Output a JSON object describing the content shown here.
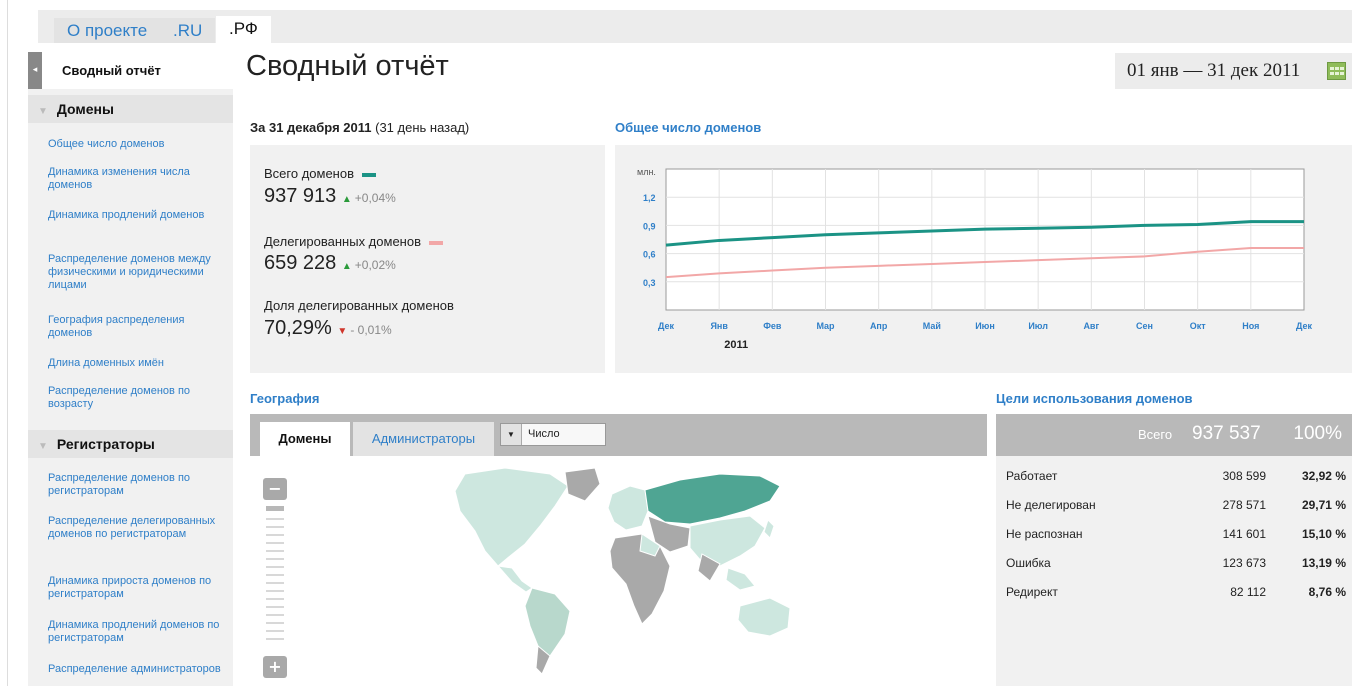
{
  "top_tabs": [
    {
      "label": "О проекте"
    },
    {
      "label": ".RU"
    },
    {
      "label": ".РФ"
    }
  ],
  "sidebar": {
    "active_item": "Сводный отчёт",
    "groups": [
      {
        "title": "Домены",
        "items": [
          "Общее число доменов",
          "Динамика изменения числа доменов",
          "Динамика продлений доменов",
          "Распределение доменов между физическими и юридическими лицами",
          "География распределения доменов",
          "Длина доменных имён",
          "Распределение доменов по возрасту"
        ]
      },
      {
        "title": "Регистраторы",
        "items": [
          "Распределение доменов по регистраторам",
          "Распределение делегированных доменов по регистраторам",
          "Динамика прироста доменов по регистраторам",
          "Динамика продлений доменов по регистраторам",
          "Распределение администраторов"
        ]
      }
    ]
  },
  "header": {
    "title": "Сводный отчёт",
    "date_range": "01 янв — 31 дек 2011"
  },
  "stats": {
    "heading_bold": "За 31 декабря 2011",
    "heading_rest": "(31 день назад)",
    "items": [
      {
        "label": "Всего доменов",
        "value": "937 913",
        "change": "+0,04%",
        "direction": "up",
        "color": "#1b9385"
      },
      {
        "label": "Делегированных доменов",
        "value": "659 228",
        "change": "+0,02%",
        "direction": "up",
        "color": "#f2a7a7"
      },
      {
        "label": "Доля делегированных доменов",
        "value": "70,29%",
        "change": "- 0,01%",
        "direction": "down"
      }
    ]
  },
  "chart_title": "Общее число доменов",
  "chart_data": {
    "type": "line",
    "unit_label": "млн.",
    "x": [
      "Дек",
      "Янв",
      "Фев",
      "Мар",
      "Апр",
      "Май",
      "Июн",
      "Июл",
      "Авг",
      "Сен",
      "Окт",
      "Ноя",
      "Дек"
    ],
    "year_label": "2011",
    "ylim": [
      0,
      1.5
    ],
    "yticks": [
      "1,2",
      "0,9",
      "0,6",
      "0,3"
    ],
    "grid": true,
    "series": [
      {
        "color": "#1b9385",
        "values": [
          0.69,
          0.74,
          0.77,
          0.8,
          0.82,
          0.84,
          0.86,
          0.87,
          0.88,
          0.9,
          0.91,
          0.94,
          0.94
        ]
      },
      {
        "color": "#f2a7a7",
        "values": [
          0.35,
          0.39,
          0.42,
          0.45,
          0.47,
          0.49,
          0.51,
          0.53,
          0.55,
          0.57,
          0.62,
          0.66,
          0.66
        ]
      }
    ]
  },
  "geo": {
    "title": "География",
    "tabs": [
      "Домены",
      "Администраторы"
    ],
    "select_value": "Число",
    "zoom_in": "+",
    "zoom_out": "−"
  },
  "purposes": {
    "title": "Цели использования доменов",
    "total_label": "Всего",
    "total": "937 537",
    "total_pct": "100%",
    "rows": [
      {
        "name": "Работает",
        "count": "308 599",
        "pct": "32,92 %"
      },
      {
        "name": "Не делегирован",
        "count": "278 571",
        "pct": "29,71 %"
      },
      {
        "name": "Не распознан",
        "count": "141 601",
        "pct": "15,10 %"
      },
      {
        "name": "Ошибка",
        "count": "123 673",
        "pct": "13,19 %"
      },
      {
        "name": "Редирект",
        "count": "82 112",
        "pct": "8,76 %"
      }
    ]
  },
  "colors": {
    "accent_link": "#2f7fc8",
    "map_highlight": "#4fa593",
    "map_light": "#cde7df",
    "map_gray": "#a9a9a9"
  }
}
